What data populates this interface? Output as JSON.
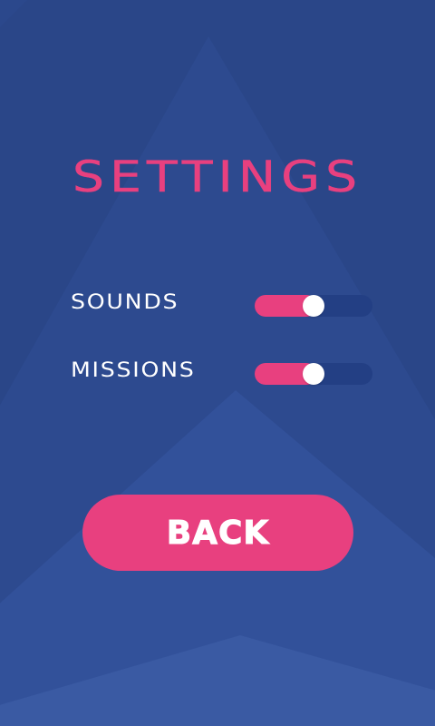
{
  "title": "SETTINGS",
  "settings": [
    {
      "label": "SOUNDS",
      "level": 0.5
    },
    {
      "label": "MISSIONS",
      "level": 0.5
    }
  ],
  "back_label": "BACK",
  "colors": {
    "background": "#2a4688",
    "accent": "#e8407f",
    "track": "#233f84",
    "knob": "#ffffff",
    "text": "#ffffff"
  }
}
